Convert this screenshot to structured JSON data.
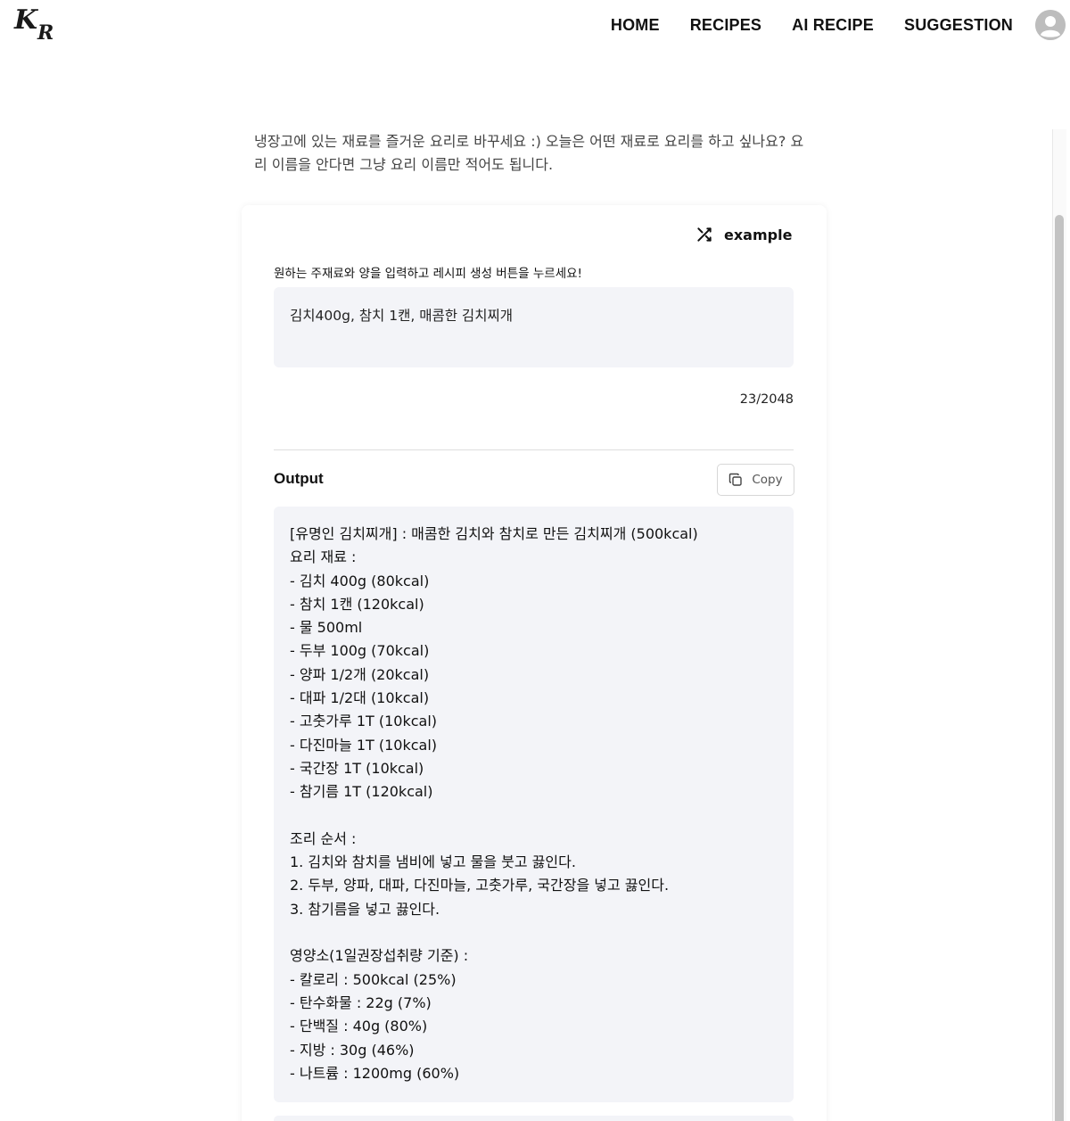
{
  "header": {
    "logo": {
      "line1": "K",
      "line2": "R"
    },
    "nav": [
      {
        "label": "HOME"
      },
      {
        "label": "RECIPES"
      },
      {
        "label": "AI RECIPE"
      },
      {
        "label": "SUGGESTION"
      }
    ]
  },
  "intro": "냉장고에 있는 재료를 즐거운 요리로 바꾸세요 :) 오늘은 어떤 재료로 요리를 하고 싶나요? 요리 이름을 안다면 그냥 요리 이름만 적어도 됩니다.",
  "example_label": "example",
  "prompt": {
    "label": "원하는 주재료와 양을 입력하고 레시피 생성 버튼을 누르세요!",
    "value": "김치400g, 참치 1캔, 매콤한 김치찌개",
    "counter": "23/2048"
  },
  "output": {
    "title": "Output",
    "copy_label": "Copy",
    "lines": [
      "[유명인 김치찌개] : 매콤한 김치와 참치로 만든 김치찌개 (500kcal)",
      "요리 재료 :",
      "- 김치 400g (80kcal)",
      "- 참치 1캔 (120kcal)",
      "- 물 500ml",
      "- 두부 100g (70kcal)",
      "- 양파 1/2개 (20kcal)",
      "- 대파 1/2대 (10kcal)",
      "- 고춧가루 1T (10kcal)",
      "- 다진마늘 1T (10kcal)",
      "- 국간장 1T (10kcal)",
      "- 참기름 1T (120kcal)",
      "",
      "조리 순서 :",
      "1. 김치와 참치를 냄비에 넣고 물을 붓고 끓인다.",
      "2. 두부, 양파, 대파, 다진마늘, 고춧가루, 국간장을 넣고 끓인다.",
      "3. 참기름을 넣고 끓인다.",
      "",
      "영양소(1일권장섭취량 기준) :",
      "- 칼로리 : 500kcal (25%)",
      "- 탄수화물 : 22g (7%)",
      "- 단백질 : 40g (80%)",
      "- 지방 : 30g (46%)",
      "- 나트륨 : 1200mg (60%)"
    ]
  }
}
